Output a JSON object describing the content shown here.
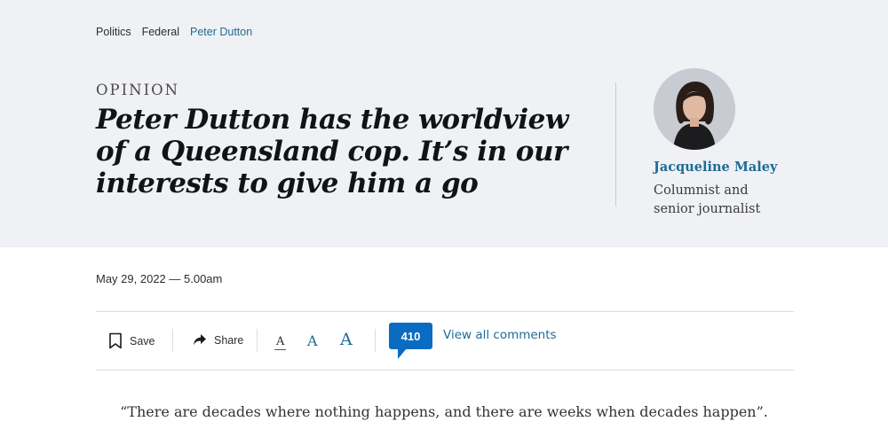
{
  "breadcrumb": [
    "Politics",
    "Federal",
    "Peter Dutton"
  ],
  "kicker": "OPINION",
  "headline": "Peter Dutton has the worldview of a Queensland cop. It’s in our interests to give him a go",
  "author": {
    "name": "Jacqueline Maley",
    "role": "Columnist and senior journalist"
  },
  "dateline": "May 29, 2022 — 5.00am",
  "toolbar": {
    "save_label": "Save",
    "share_label": "Share",
    "font_size_glyph": "A",
    "comment_count": "410",
    "view_comments_label": "View all comments"
  },
  "body": {
    "quote": "“There are decades where nothing happens, and there are weeks when decades happen”."
  },
  "colors": {
    "accent": "#1f6b95",
    "badge": "#0a6bc2",
    "hero_bg": "#f0f1f4"
  }
}
